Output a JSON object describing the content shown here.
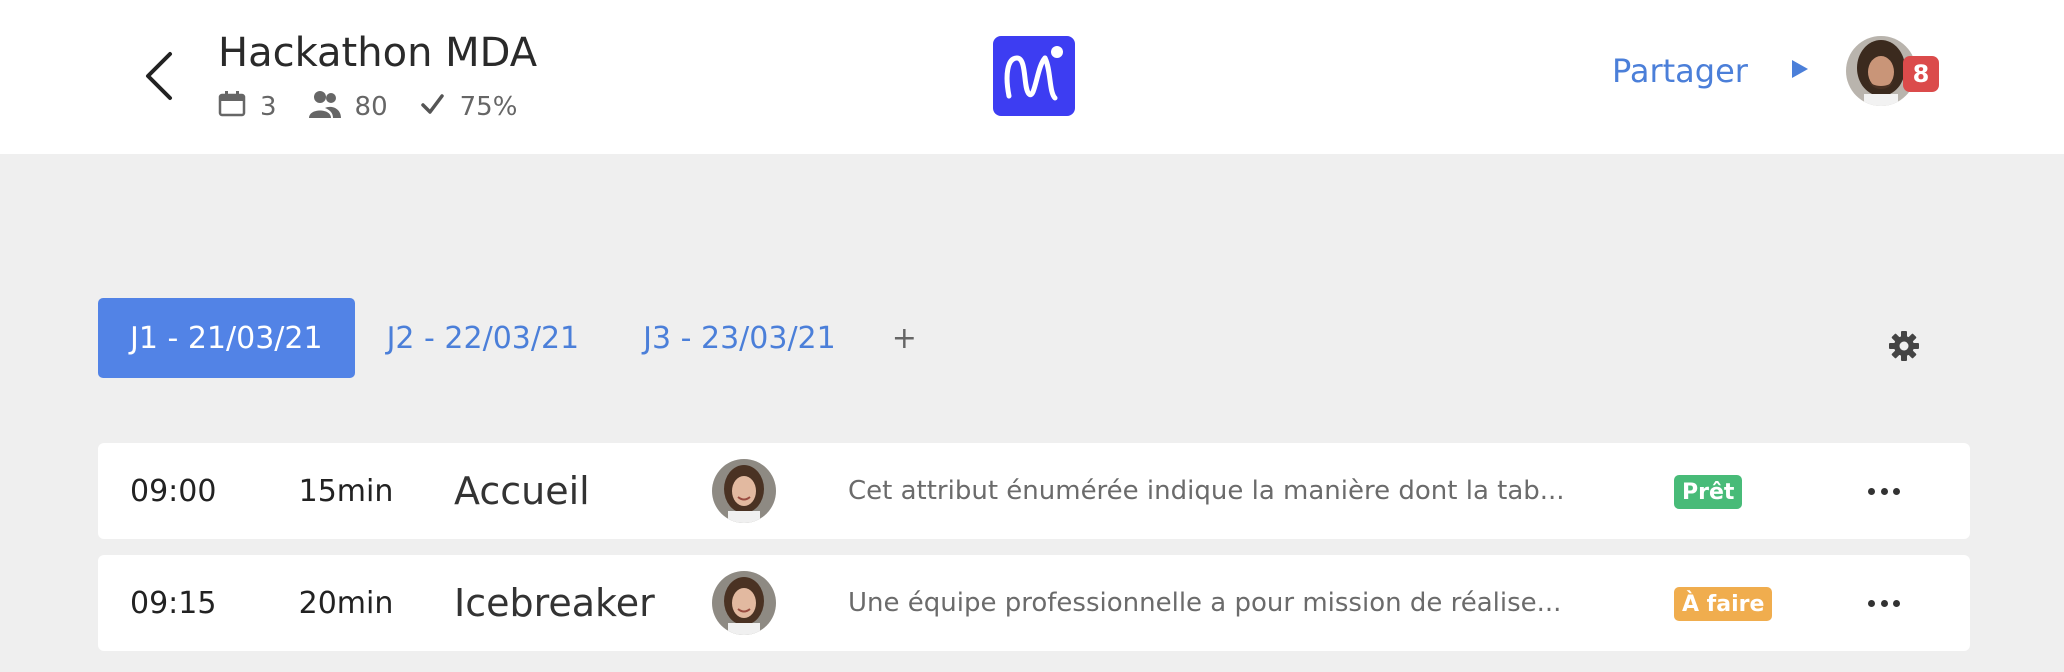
{
  "header": {
    "title": "Hackathon MDA",
    "stats": {
      "days": "3",
      "participants": "80",
      "progress": "75%"
    },
    "share_label": "Partager",
    "notification_count": "8"
  },
  "tabs": [
    {
      "label": "J1 - 21/03/21",
      "active": true
    },
    {
      "label": "J2 - 22/03/21",
      "active": false
    },
    {
      "label": "J3 - 23/03/21",
      "active": false
    }
  ],
  "add_tab_label": "+",
  "rows": [
    {
      "time": "09:00",
      "duration": "15min",
      "name": "Accueil",
      "description": "Cet attribut énumérée indique la manière dont la tab...",
      "status": "Prêt",
      "status_color": "#48bb78"
    },
    {
      "time": "09:15",
      "duration": "20min",
      "name": "Icebreaker",
      "description": "Une équipe professionnelle a pour mission de réalise...",
      "status": "À faire",
      "status_color": "#f0ad4e"
    }
  ],
  "colors": {
    "accent": "#5283e6",
    "link": "#4b7fd9",
    "logo": "#3d3df2",
    "notification": "#db4b4b"
  },
  "icons": [
    "back-arrow-icon",
    "calendar-icon",
    "people-icon",
    "check-icon",
    "logo-icon",
    "play-icon",
    "gear-icon",
    "more-icon"
  ]
}
